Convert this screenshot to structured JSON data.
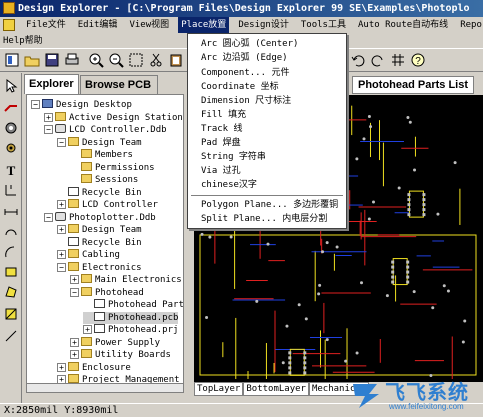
{
  "window": {
    "title": "Design Explorer - [C:\\Program Files\\Design Explorer 99 SE\\Examples\\Photoplo"
  },
  "menubar": {
    "items": [
      {
        "label": "File文件"
      },
      {
        "label": "Edit编辑"
      },
      {
        "label": "View视图"
      },
      {
        "label": "Place放置",
        "active": true
      },
      {
        "label": "Design设计"
      },
      {
        "label": "Tools工具"
      },
      {
        "label": "Auto Route自动布线"
      },
      {
        "label": "Reports报"
      }
    ],
    "help": "Help帮助"
  },
  "explorer": {
    "tabs": [
      "Explorer",
      "Browse PCB"
    ],
    "tree": [
      {
        "label": "Design Desktop",
        "icon": "desktop",
        "depth": 0,
        "expander": "-"
      },
      {
        "label": "Active Design Stations",
        "icon": "folder",
        "depth": 1,
        "expander": "+"
      },
      {
        "label": "LCD Controller.Ddb",
        "icon": "database",
        "depth": 1,
        "expander": "-"
      },
      {
        "label": "Design Team",
        "icon": "folder",
        "depth": 2,
        "expander": "-"
      },
      {
        "label": "Members",
        "icon": "folder",
        "depth": 3,
        "expander": ""
      },
      {
        "label": "Permissions",
        "icon": "folder",
        "depth": 3,
        "expander": ""
      },
      {
        "label": "Sessions",
        "icon": "folder",
        "depth": 3,
        "expander": ""
      },
      {
        "label": "Recycle Bin",
        "icon": "recycle",
        "depth": 2,
        "expander": ""
      },
      {
        "label": "LCD Controller",
        "icon": "folder",
        "depth": 2,
        "expander": "+"
      },
      {
        "label": "Photoplotter.Ddb",
        "icon": "database",
        "depth": 1,
        "expander": "-"
      },
      {
        "label": "Design Team",
        "icon": "folder",
        "depth": 2,
        "expander": "+"
      },
      {
        "label": "Recycle Bin",
        "icon": "recycle",
        "depth": 2,
        "expander": ""
      },
      {
        "label": "Cabling",
        "icon": "folder",
        "depth": 2,
        "expander": "+"
      },
      {
        "label": "Electronics",
        "icon": "folder",
        "depth": 2,
        "expander": "-"
      },
      {
        "label": "Main Electronics",
        "icon": "folder",
        "depth": 3,
        "expander": "+"
      },
      {
        "label": "Photohead",
        "icon": "folder",
        "depth": 3,
        "expander": "-"
      },
      {
        "label": "Photohead Part",
        "icon": "file",
        "depth": 4,
        "expander": ""
      },
      {
        "label": "Photohead.pcb",
        "icon": "file",
        "depth": 4,
        "expander": "",
        "selected": true
      },
      {
        "label": "Photohead.prj",
        "icon": "file",
        "depth": 4,
        "expander": "+"
      },
      {
        "label": "Power Supply",
        "icon": "folder",
        "depth": 3,
        "expander": "+"
      },
      {
        "label": "Utility Boards",
        "icon": "folder",
        "depth": 3,
        "expander": "+"
      },
      {
        "label": "Enclosure",
        "icon": "folder",
        "depth": 2,
        "expander": "+"
      },
      {
        "label": "Project Management",
        "icon": "folder",
        "depth": 2,
        "expander": "+"
      }
    ]
  },
  "place_menu": {
    "items": [
      {
        "label": "Arc 圆心弧 (Center)"
      },
      {
        "label": "Arc 边沿弧 (Edge)"
      },
      {
        "label": "Component... 元件"
      },
      {
        "label": "Coordinate 坐标"
      },
      {
        "label": "Dimension 尺寸标注"
      },
      {
        "label": "Fill 填充"
      },
      {
        "label": "Track 线"
      },
      {
        "label": "Pad 焊盘"
      },
      {
        "label": "String 字符串"
      },
      {
        "label": "Via 过孔"
      },
      {
        "label": "chinese汉字"
      },
      {
        "label": "Polygon Plane... 多边形覆铜"
      },
      {
        "label": "Split Plane... 内电层分割"
      }
    ]
  },
  "document": {
    "tab": "Photohead Parts List",
    "layers": [
      "TopLayer",
      "BottomLayer",
      "Mechanical"
    ]
  },
  "status": {
    "coords": "X:2850mil Y:8930mil"
  },
  "watermark": {
    "brand": "飞飞系统",
    "url": "www.feifeixitong.com"
  },
  "colors": {
    "title_bar": "#0a246a",
    "menu_highlight": "#0a246a",
    "pcb_background": "#000000",
    "track_yellow": "#f0e020",
    "track_red": "#e02020",
    "track_blue": "#2040e0",
    "pad_gray": "#c0c0c0"
  }
}
